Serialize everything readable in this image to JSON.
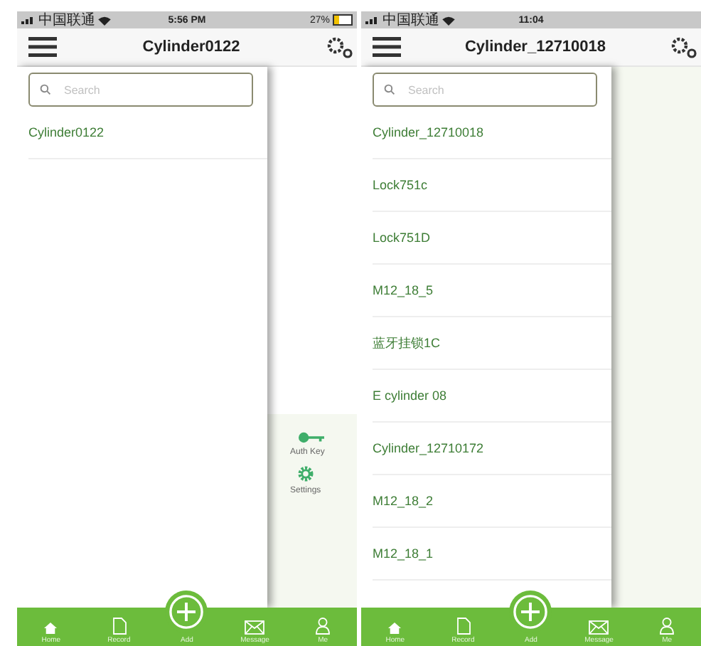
{
  "phones": [
    {
      "status_bar": {
        "carrier": "中国联通",
        "time": "5:56 PM",
        "battery": "27%"
      },
      "title": "Cylinder0122",
      "search": {
        "placeholder": "Search"
      },
      "devices": [
        "Cylinder0122"
      ],
      "side_menu": [
        {
          "label": "Auth Key",
          "kind": "key"
        },
        {
          "label": "Settings",
          "kind": "gear"
        }
      ],
      "tabs": [
        {
          "label": "Home",
          "kind": "home"
        },
        {
          "label": "Record",
          "kind": "record"
        },
        {
          "label": "Add",
          "kind": "add"
        },
        {
          "label": "Message",
          "kind": "message"
        },
        {
          "label": "Me",
          "kind": "me"
        }
      ]
    },
    {
      "status_bar": {
        "carrier": "中国联通",
        "time": "11:04"
      },
      "title": "Cylinder_12710018",
      "search": {
        "placeholder": "Search"
      },
      "devices": [
        "Cylinder_12710018",
        "Lock751c",
        "Lock751D",
        "M12_18_5",
        "蓝牙挂锁1C",
        "E cylinder 08",
        "Cylinder_12710172",
        "M12_18_2",
        "M12_18_1"
      ],
      "tabs": [
        {
          "label": "Home",
          "kind": "home"
        },
        {
          "label": "Record",
          "kind": "record"
        },
        {
          "label": "Add",
          "kind": "add"
        },
        {
          "label": "Message",
          "kind": "message"
        },
        {
          "label": "Me",
          "kind": "me"
        }
      ]
    }
  ]
}
